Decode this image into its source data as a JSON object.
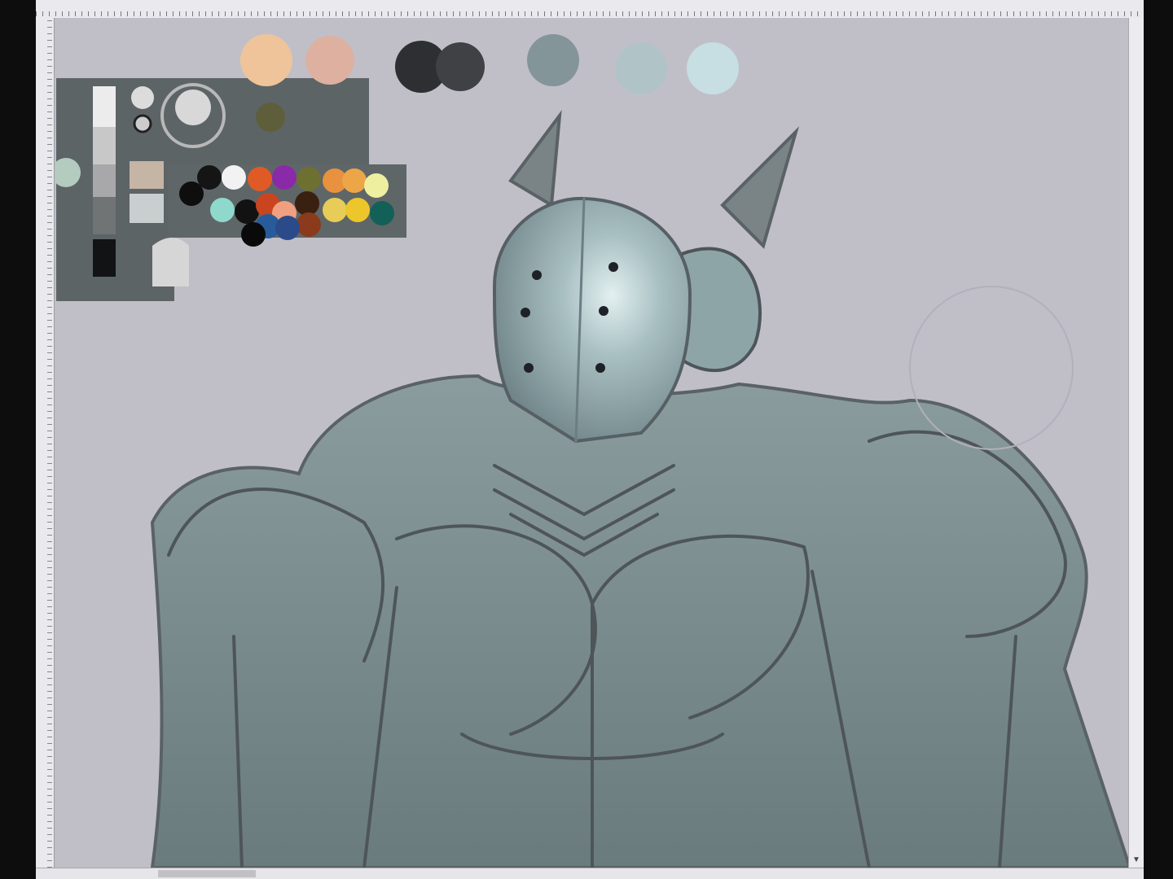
{
  "app": {
    "type": "digital-painting-editor"
  },
  "colors": {
    "canvas_bg": "#c0bfc8",
    "armor_mid": "#7f9294",
    "armor_dark": "#5d6b6e",
    "helmet_light": "#b9cfd2",
    "line": "#4e5558",
    "palette_panel": "#5d6466"
  },
  "top_swatches": [
    "#efc49a",
    "#ddb0a0",
    "#2e2f33",
    "#3f4145",
    "#84959a",
    "#b0c4c8",
    "#c7dee2"
  ],
  "palette_colors": [
    "#0e0e0e",
    "#151515",
    "#f2f2f2",
    "#e05a25",
    "#8a2aa8",
    "#6e7032",
    "#e8913e",
    "#eda647",
    "#eef0a0",
    "#8fd8cc",
    "#121212",
    "#cb4420",
    "#f0a080",
    "#3a2010",
    "#8b3a1c",
    "#e8cc58",
    "#ecc62a",
    "#136058",
    "#285b9a",
    "#2a4a8a",
    "#0a0a0a"
  ]
}
